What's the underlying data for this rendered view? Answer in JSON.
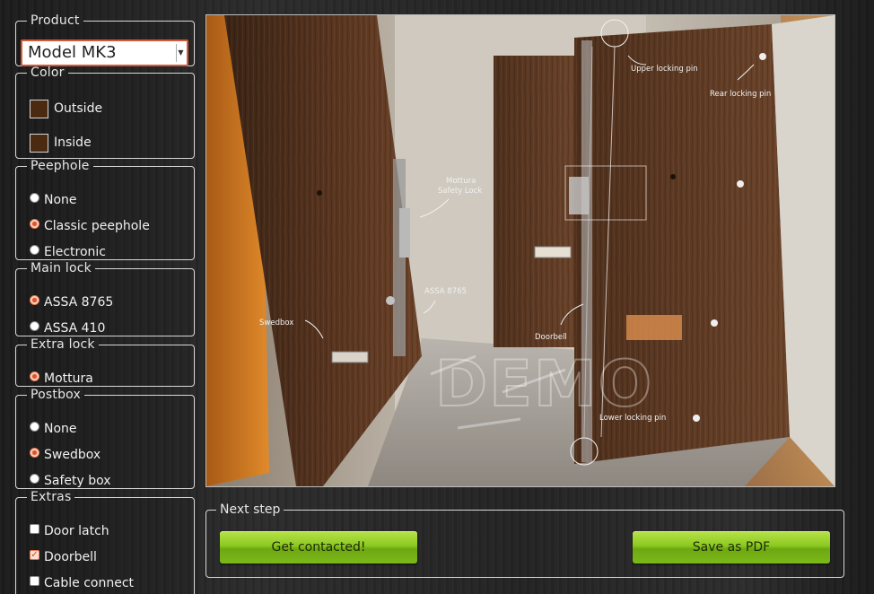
{
  "product": {
    "legend": "Product",
    "selected": "Model MK3"
  },
  "color": {
    "legend": "Color",
    "outside_label": "Outside",
    "inside_label": "Inside",
    "outside_color": "#4a2a10",
    "inside_color": "#4a2a10"
  },
  "peephole": {
    "legend": "Peephole",
    "options": [
      "None",
      "Classic peephole",
      "Electronic"
    ],
    "selected": "Classic peephole"
  },
  "main_lock": {
    "legend": "Main lock",
    "options": [
      "ASSA 8765",
      "ASSA 410"
    ],
    "selected": "ASSA 8765"
  },
  "extra_lock": {
    "legend": "Extra lock",
    "options": [
      "Mottura"
    ],
    "selected": "Mottura"
  },
  "postbox": {
    "legend": "Postbox",
    "options": [
      "None",
      "Swedbox",
      "Safety box"
    ],
    "selected": "Swedbox"
  },
  "extras": {
    "legend": "Extras",
    "options": [
      "Door latch",
      "Doorbell",
      "Cable connect"
    ],
    "checked": [
      "Doorbell"
    ]
  },
  "preview": {
    "callouts": {
      "upper_pin": "Upper locking pin",
      "rear_pin": "Rear locking pin",
      "mottura_line1": "Mottura",
      "mottura_line2": "Safety Lock",
      "assa": "ASSA 8765",
      "swedbox": "Swedbox",
      "doorbell": "Doorbell",
      "lower_pin": "Lower locking pin"
    },
    "watermark": "DEMO",
    "colors": {
      "door_wood": "#5b3620",
      "frame_orange": "#d77a22",
      "wall": "#cfc9bf"
    }
  },
  "next_step": {
    "legend": "Next step",
    "contact_label": "Get contacted!",
    "pdf_label": "Save as PDF"
  },
  "accent": "#8cc920"
}
